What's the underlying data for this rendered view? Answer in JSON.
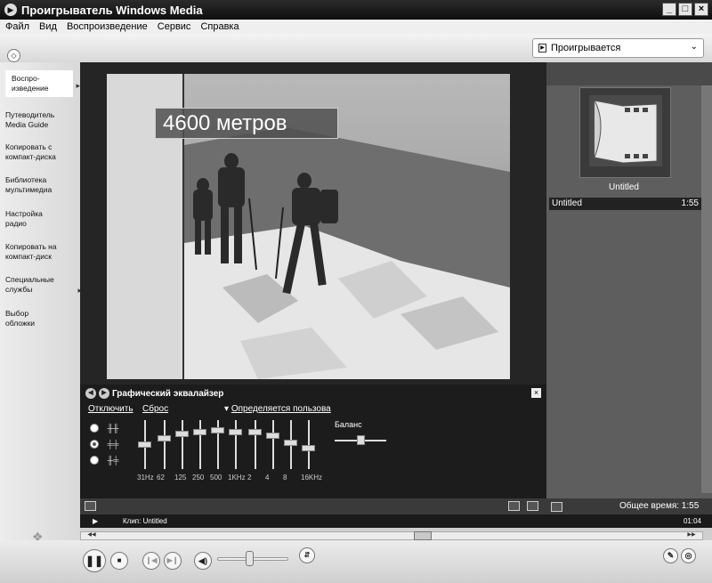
{
  "window": {
    "title": "Проигрыватель Windows Media"
  },
  "menu": [
    "Файл",
    "Вид",
    "Воспроизведение",
    "Сервис",
    "Справка"
  ],
  "now_playing_select": "Проигрывается",
  "sidebar": {
    "items": [
      {
        "label": "Воспро-\nизведение"
      },
      {
        "label": "Путеводитель\nMedia Guide"
      },
      {
        "label": "Копировать с\nкомпакт-диска"
      },
      {
        "label": "Библиотека\nмультимедиа"
      },
      {
        "label": "Настройка\nрадио"
      },
      {
        "label": "Копировать на\nкомпакт-диск"
      },
      {
        "label": "Специальные\nслужбы"
      },
      {
        "label": "Выбор\nобложки"
      }
    ]
  },
  "video": {
    "caption": "4600 метров"
  },
  "playlist": {
    "album_title": "Untitled",
    "items": [
      {
        "title": "Untitled",
        "duration": "1:55"
      }
    ],
    "total": "Общее время: 1:55"
  },
  "equalizer": {
    "title": "Графический эквалайзер",
    "off_link": "Отключить",
    "reset_link": "Сброс",
    "preset_link": "Определяется пользова",
    "balance_label": "Баланс",
    "bands": [
      "31Hz",
      "62",
      "125",
      "250",
      "500",
      "1KHz",
      "2",
      "4",
      "8",
      "16KHz"
    ],
    "levels": [
      0.5,
      0.35,
      0.25,
      0.2,
      0.17,
      0.2,
      0.2,
      0.3,
      0.45,
      0.58
    ],
    "balance": 0.5
  },
  "status": {
    "clip": "Клип: Untitled",
    "time": "01:04"
  },
  "playback": {
    "position": 0.55,
    "volume": 0.45
  },
  "icons": {
    "app": "wmp-icon",
    "pause": "pause-icon",
    "stop": "stop-icon",
    "prev": "previous-icon",
    "next": "next-icon",
    "mute": "volume-icon"
  }
}
